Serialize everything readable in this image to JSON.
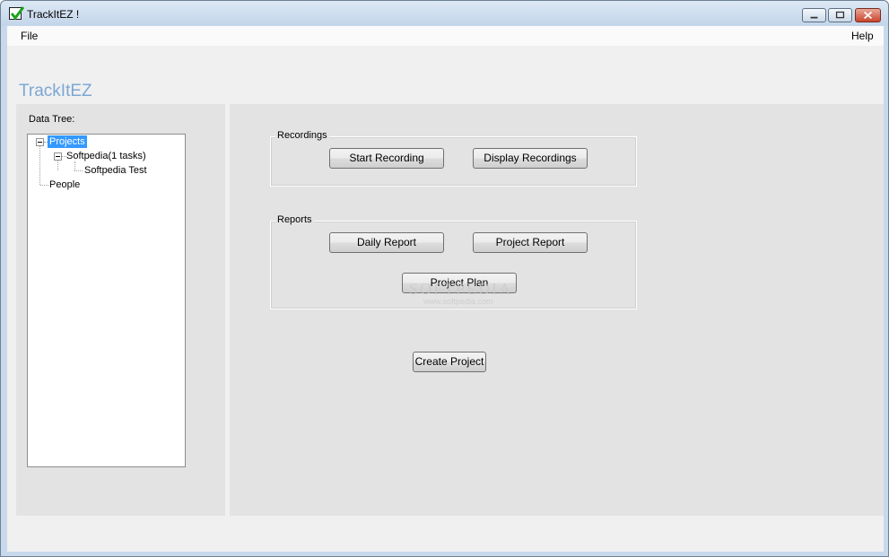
{
  "window": {
    "title": "TrackItEZ !",
    "icon": "checkmark-icon"
  },
  "menu": {
    "file": "File",
    "help": "Help"
  },
  "brand": "TrackItEZ",
  "tree": {
    "label": "Data Tree:",
    "nodes": {
      "projects": "Projects",
      "softpedia": "Softpedia(1 tasks)",
      "softpedia_test": "Softpedia Test",
      "people": "People"
    }
  },
  "recordings": {
    "label": "Recordings",
    "start": "Start Recording",
    "display": "Display Recordings"
  },
  "reports": {
    "label": "Reports",
    "daily": "Daily Report",
    "project": "Project Report",
    "plan": "Project Plan"
  },
  "create_project": "Create Project",
  "watermark": {
    "main": "SOFTPEDIA",
    "sub": "www.softpedia.com"
  },
  "colors": {
    "selection": "#3399ff",
    "brand": "#7ba7d6",
    "panel": "#e3e3e3"
  }
}
